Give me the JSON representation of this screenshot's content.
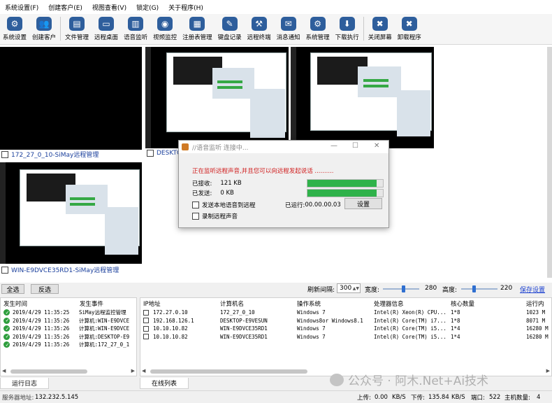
{
  "menu": [
    "系统设置(F)",
    "创建客户(E)",
    "视图查看(V)",
    "锁定(G)",
    "关于程序(H)"
  ],
  "toolbar": {
    "items": [
      {
        "label": "系统设置",
        "icon": "gear-icon",
        "glyph": "⚙"
      },
      {
        "label": "创建客户",
        "icon": "users-icon",
        "glyph": "👥"
      },
      {
        "label": "文件管理",
        "icon": "folder-icon",
        "glyph": "▤"
      },
      {
        "label": "远程桌面",
        "icon": "monitor-icon",
        "glyph": "▭"
      },
      {
        "label": "语音监听",
        "icon": "audio-bars-icon",
        "glyph": "▥"
      },
      {
        "label": "视频监控",
        "icon": "camera-icon",
        "glyph": "◉"
      },
      {
        "label": "注册表管理",
        "icon": "registry-icon",
        "glyph": "▦"
      },
      {
        "label": "键盘记录",
        "icon": "pencil-icon",
        "glyph": "✎"
      },
      {
        "label": "远程终端",
        "icon": "wrench-icon",
        "glyph": "⚒"
      },
      {
        "label": "消息通知",
        "icon": "chat-bubble-icon",
        "glyph": "✉"
      },
      {
        "label": "系统管理",
        "icon": "gear-icon",
        "glyph": "⚙"
      },
      {
        "label": "下载执行",
        "icon": "download-icon",
        "glyph": "⬇"
      },
      {
        "label": "关闭屏幕",
        "icon": "close-x-icon",
        "glyph": "✖"
      },
      {
        "label": "卸载程序",
        "icon": "close-x-icon",
        "glyph": "✖"
      }
    ]
  },
  "desktops": [
    {
      "caption": "172_27_0_10-SiMay远程管理"
    },
    {
      "caption": "DESKTOP-"
    },
    {
      "caption": ""
    },
    {
      "caption": "WIN-E9DVCE35RD1-SiMay远程管理"
    }
  ],
  "dialog": {
    "title": "//语音监听 连接中...",
    "message": "正在监听远程声音,并且您可以向远程发起说话 ..........",
    "received_label": "已接收:",
    "received_value": "121 KB",
    "sent_label": "已发送:",
    "sent_value": "0 KB",
    "progress_received": 0.92,
    "progress_sent": 0.92,
    "send_local_label": "发送本地语音到远程",
    "record_label": "录制远程声音",
    "runtime_label": "已运行:",
    "runtime_value": "00.00.00.03",
    "settings_button": "设置"
  },
  "controls": {
    "select_all": "全选",
    "invert": "反选",
    "refresh_label": "刷新间隔:",
    "refresh_value": "300",
    "width_label": "宽度:",
    "width_value": "280",
    "height_label": "高度:",
    "height_value": "220",
    "save_settings": "保存设置",
    "width_slider_level": 0.55,
    "height_slider_level": 0.35
  },
  "log": {
    "headers": [
      "发生时间",
      "发生事件"
    ],
    "rows": [
      {
        "time": "2019/4/29 11:35:25",
        "event": "SiMay远程监控管理"
      },
      {
        "time": "2019/4/29 11:35:26",
        "event": "计算机:WIN-E9DVCE"
      },
      {
        "time": "2019/4/29 11:35:26",
        "event": "计算机:WIN-E9DVCE"
      },
      {
        "time": "2019/4/29 11:35:26",
        "event": "计算机:DESKTOP-E9"
      },
      {
        "time": "2019/4/29 11:35:26",
        "event": "计算机:172_27_0_1"
      }
    ]
  },
  "online": {
    "headers": [
      "IP地址",
      "计算机名",
      "操作系统",
      "处理器信息",
      "核心数量",
      "运行内"
    ],
    "rows": [
      {
        "ip": "172.27.0.10",
        "name": "172_27_0_10",
        "os": "Windows 7",
        "cpu": "Intel(R) Xeon(R) CPU...",
        "cores": "1*8",
        "mem": "1023 M"
      },
      {
        "ip": "192.168.126.1",
        "name": "DESKTOP-E9VESUN",
        "os": "Windows8or Windows8.1",
        "cpu": "Intel(R) Core(TM) i7...",
        "cores": "1*8",
        "mem": "8071 M"
      },
      {
        "ip": "10.10.10.82",
        "name": "WIN-E9DVCE35RD1",
        "os": "Windows 7",
        "cpu": "Intel(R) Core(TM) i5...",
        "cores": "1*4",
        "mem": "16280 M"
      },
      {
        "ip": "10.10.10.82",
        "name": "WIN-E9DVCE35RD1",
        "os": "Windows 7",
        "cpu": "Intel(R) Core(TM) i5...",
        "cores": "1*4",
        "mem": "16280 M"
      }
    ]
  },
  "tabs": {
    "log": "运行日志",
    "online": "在线列表"
  },
  "status": {
    "server_label": "服务器地址:",
    "server_value": "132.232.5.145",
    "upload_label": "上传:",
    "upload_value": "0.00",
    "upload_unit": "KB/S",
    "download_label": "下传:",
    "download_value": "135.84",
    "download_unit": "KB/S",
    "port_label": "端口:",
    "port_value": "522",
    "hosts_label": "主机数量:",
    "hosts_value": "4"
  },
  "watermark": "公众号 · 阿木.Net+Ai技术"
}
